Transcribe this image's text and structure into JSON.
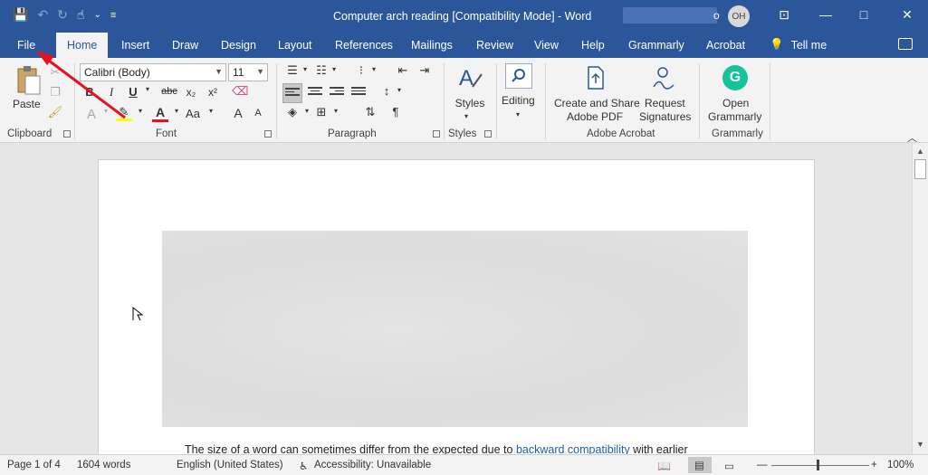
{
  "window": {
    "title": "Computer arch reading [Compatibility Mode]  -  Word",
    "account_partial": "o",
    "avatar_initials": "OH",
    "minimize": "—",
    "restore": "□",
    "close": "✕"
  },
  "qat": {
    "save": "💾",
    "undo": "↶",
    "redo": "↻",
    "touch": "☝",
    "more": "⌄",
    "customize": "≡"
  },
  "tabs": [
    "File",
    "Home",
    "Insert",
    "Draw",
    "Design",
    "Layout",
    "References",
    "Mailings",
    "Review",
    "View",
    "Help",
    "Grammarly",
    "Acrobat"
  ],
  "active_tab": "Home",
  "tell_me": "Tell me",
  "ribbon": {
    "clipboard": {
      "paste_label": "Paste",
      "group_label": "Clipboard"
    },
    "font": {
      "font_name": "Calibri (Body)",
      "font_size": "11",
      "group_label": "Font",
      "bold": "B",
      "italic": "I",
      "underline": "U",
      "strike": "abc",
      "subscript": "x₂",
      "superscript": "x²",
      "grow": "A",
      "shrink": "A",
      "font_color": "A",
      "clear": "A"
    },
    "paragraph": {
      "group_label": "Paragraph",
      "pilcrow": "¶"
    },
    "styles": {
      "label": "Styles",
      "group_label": "Styles"
    },
    "editing": {
      "label": "Editing"
    },
    "adobe": {
      "create_share": "Create and Share",
      "adobe_pdf": "Adobe PDF",
      "request": "Request",
      "signatures": "Signatures",
      "group_label": "Adobe Acrobat"
    },
    "grammarly": {
      "open": "Open",
      "grammarly": "Grammarly",
      "group_label": "Grammarly"
    }
  },
  "document": {
    "text_before": "The size of a word can sometimes ",
    "text_word1": "differ",
    "text_middle": " from the expected due to ",
    "text_link": "backward compatibility",
    "text_after": " with earlier"
  },
  "status": {
    "page": "Page 1 of 4",
    "words": "1604 words",
    "language": "English (United States)",
    "accessibility": "Accessibility: Unavailable",
    "zoom_minus": "—",
    "zoom_plus": "+",
    "zoom": "100%"
  },
  "colors": {
    "titlebar": "#2b579a",
    "ribbon": "#f3f3f3",
    "annotation_arrow": "#e81123",
    "highlight": "#ffff00",
    "font_color": "#e81123"
  }
}
